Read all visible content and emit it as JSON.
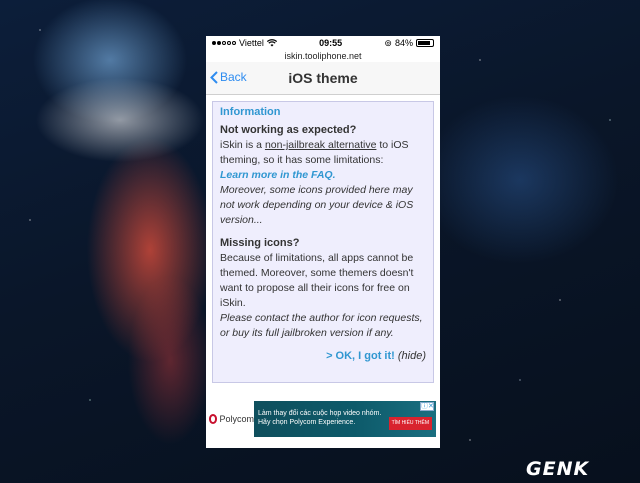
{
  "status_bar": {
    "carrier": "Viettel",
    "time": "09:55",
    "battery": "84%"
  },
  "url": "iskin.tooliphone.net",
  "nav": {
    "back_label": "Back",
    "title": "iOS theme"
  },
  "info": {
    "title": "Information",
    "section1_heading": "Not working as expected?",
    "section1_text_a": "iSkin is a ",
    "section1_link": "non-jailbreak alternative",
    "section1_text_b": " to iOS theming, so it has some limitations:",
    "faq_link": "Learn more in the FAQ.",
    "section1_italic": "Moreover, some icons provided here may not work depending on your device & iOS version...",
    "section2_heading": "Missing icons?",
    "section2_text": "Because of limitations, all apps cannot be themed. Moreover, some themers doesn't want to propose all their icons for free on iSkin.",
    "section2_italic": "Please contact the author for icon requests, or buy its full jailbroken version if any.",
    "ok_label": "> OK, I got it!",
    "hide_label": "(hide)"
  },
  "ad": {
    "brand": "Polycom",
    "line1": "Làm thay đổi các cuộc họp video nhóm.",
    "line2": "Hãy chọn Polycom Experience.",
    "cta": "TÌM HIỂU THÊM",
    "close": "ⓘ✕"
  },
  "watermark": "GENK",
  "colors": {
    "accent": "#3097d1",
    "ios_blue": "#2e8cf0",
    "info_bg": "#efeefd"
  }
}
